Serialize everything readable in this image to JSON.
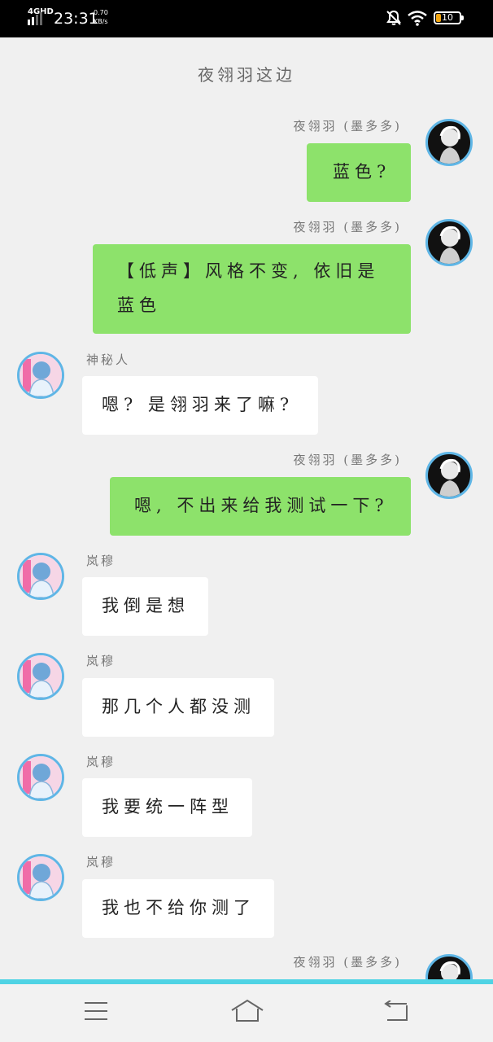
{
  "status": {
    "network": "4GHD",
    "time": "23:31",
    "speed_value": "0.70",
    "speed_unit": "KB/s",
    "battery_level": "10",
    "icons": [
      "signal-icon",
      "mute-bell-icon",
      "wifi-icon",
      "battery-icon"
    ]
  },
  "chat": {
    "title": "夜翎羽这边",
    "messages": [
      {
        "side": "right",
        "sender": "夜翎羽 (墨多多)",
        "text": "蓝色?"
      },
      {
        "side": "right",
        "sender": "夜翎羽 (墨多多)",
        "line1": "【低声】风格不变, 依旧是",
        "line2": "蓝色"
      },
      {
        "side": "left",
        "sender": "神秘人",
        "text": "嗯? 是翎羽来了嘛?"
      },
      {
        "side": "right",
        "sender": "夜翎羽 (墨多多)",
        "text": "嗯, 不出来给我测试一下?"
      },
      {
        "side": "left",
        "sender": "岚穆",
        "text": "我倒是想"
      },
      {
        "side": "left",
        "sender": "岚穆",
        "text": "那几个人都没测"
      },
      {
        "side": "left",
        "sender": "岚穆",
        "text": "我要统一阵型"
      },
      {
        "side": "left",
        "sender": "岚穆",
        "text": "我也不给你测了"
      },
      {
        "side": "right",
        "sender": "夜翎羽 (墨多多)",
        "text": ""
      }
    ]
  },
  "nav": {
    "menu": "menu-icon",
    "home": "home-icon",
    "back": "back-icon"
  },
  "colors": {
    "green_bubble": "#8de26b",
    "white_bubble": "#ffffff",
    "accent_bar": "#4fd3e4",
    "avatar_ring": "#5fb6e6"
  }
}
